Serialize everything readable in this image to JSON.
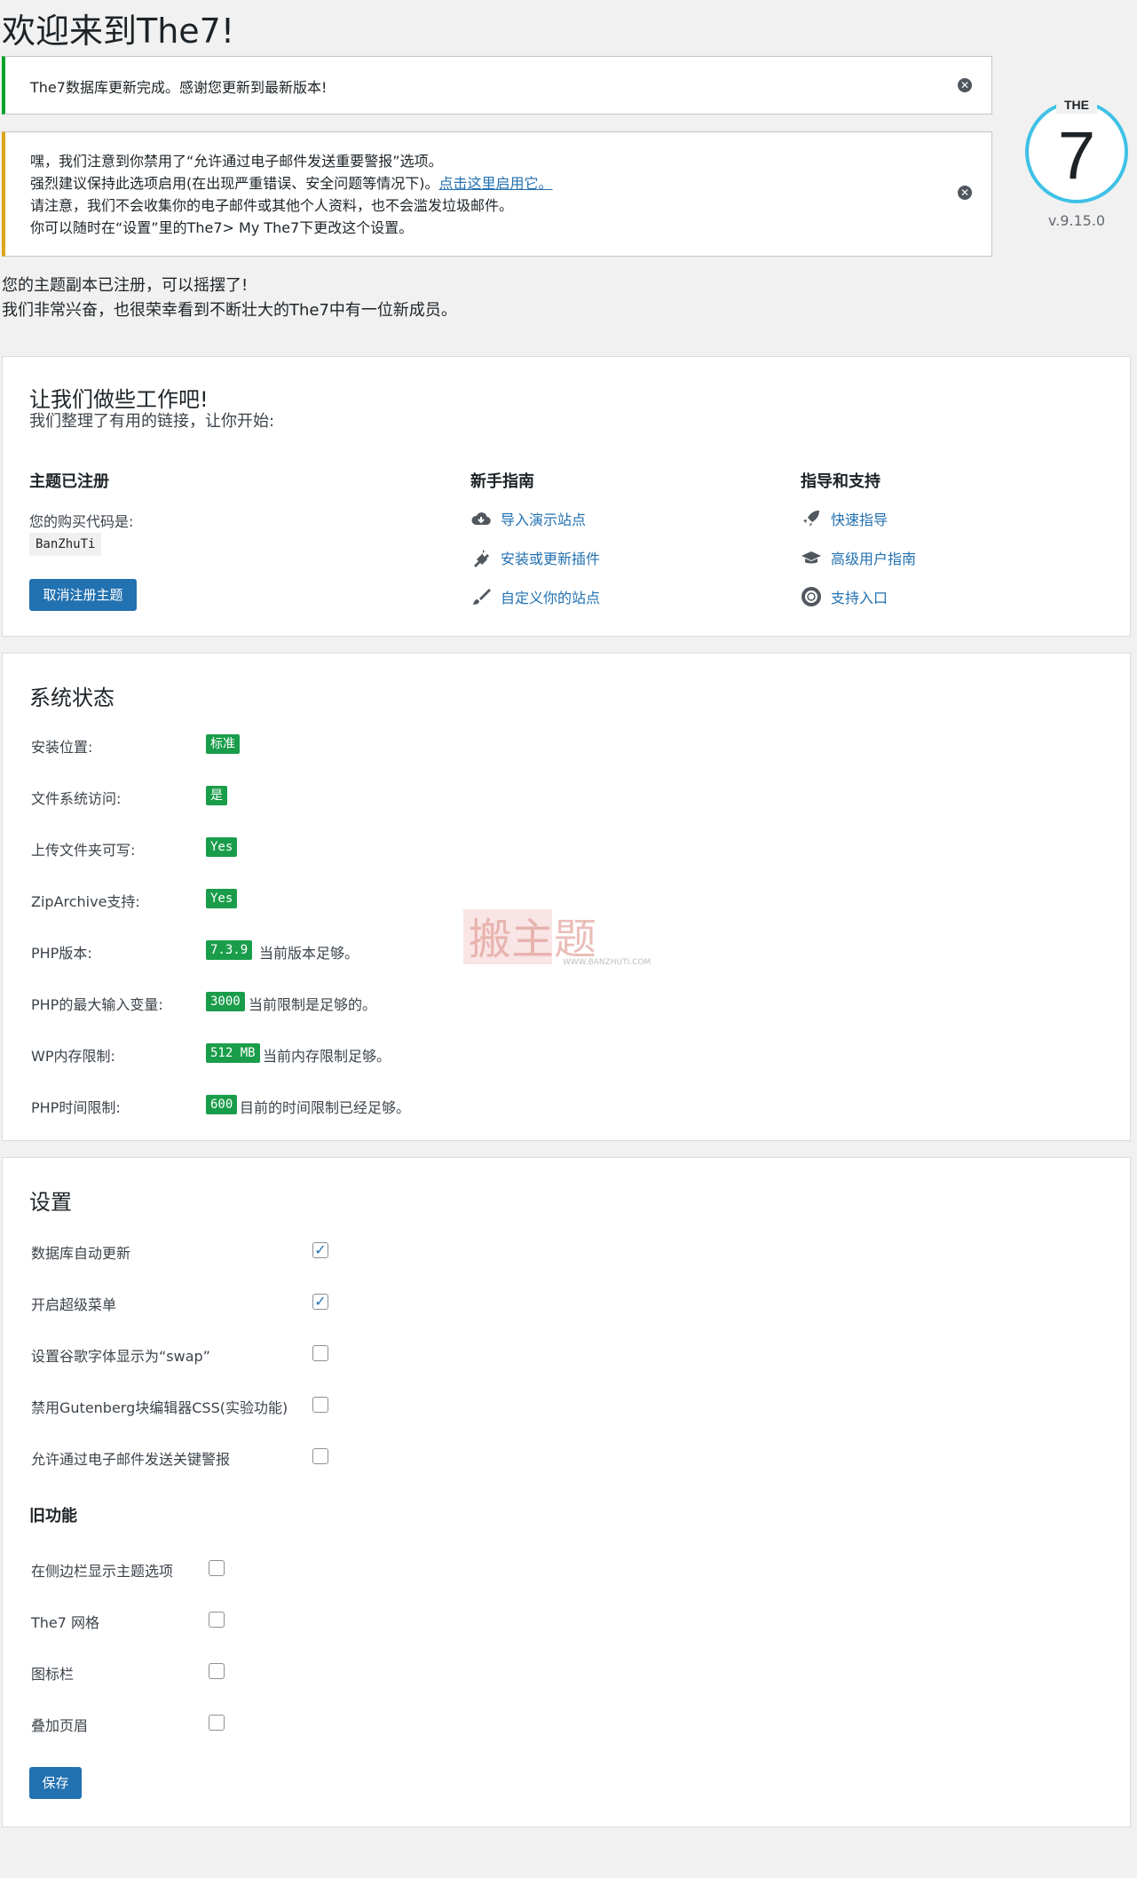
{
  "page_title": "欢迎来到The7!",
  "notices": {
    "success": "The7数据库更新完成。感谢您更新到最新版本!",
    "warning_line1": "嘿，我们注意到你禁用了“允许通过电子邮件发送重要警报”选项。",
    "warning_line2": "强烈建议保持此选项启用(在出现严重错误、安全问题等情况下)。",
    "warning_link": "点击这里启用它。",
    "warning_line3": "请注意，我们不会收集你的电子邮件或其他个人资料，也不会滥发垃圾邮件。",
    "warning_line4": "你可以随时在“设置”里的The7> My The7下更改这个设置。",
    "dismiss_glyph": "✕"
  },
  "logo": {
    "label": "THE",
    "number": "7",
    "version": "v.9.15.0"
  },
  "intro": {
    "line1": "您的主题副本已注册，可以摇摆了!",
    "line2": "我们非常兴奋，也很荣幸看到不断壮大的The7中有一位新成员。"
  },
  "getting_started": {
    "heading": "让我们做些工作吧!",
    "subheading": "我们整理了有用的链接，让你开始:",
    "registered": {
      "heading": "主题已注册",
      "code_label": "您的购买代码是:",
      "code": "BanZhuTi",
      "deregister_button": "取消注册主题"
    },
    "guide": {
      "heading": "新手指南",
      "items": [
        {
          "label": "导入演示站点",
          "icon": "cloud-download-icon"
        },
        {
          "label": "安装或更新插件",
          "icon": "plugin-icon"
        },
        {
          "label": "自定义你的站点",
          "icon": "brush-icon"
        }
      ]
    },
    "support": {
      "heading": "指导和支持",
      "items": [
        {
          "label": "快速指导",
          "icon": "rocket-icon"
        },
        {
          "label": "高级用户指南",
          "icon": "graduation-cap-icon"
        },
        {
          "label": "支持入口",
          "icon": "lifebuoy-icon"
        }
      ]
    }
  },
  "system_status": {
    "heading": "系统状态",
    "rows": [
      {
        "label": "安装位置:",
        "value": "标准",
        "note": ""
      },
      {
        "label": "文件系统访问:",
        "value": "是",
        "note": ""
      },
      {
        "label": "上传文件夹可写:",
        "value": "Yes",
        "note": ""
      },
      {
        "label": "ZipArchive支持:",
        "value": "Yes",
        "note": ""
      },
      {
        "label": "PHP版本:",
        "value": "7.3.9",
        "note": "当前版本足够。"
      },
      {
        "label": "PHP的最大输入变量:",
        "value": "3000",
        "note": "当前限制是足够的。"
      },
      {
        "label": "WP内存限制:",
        "value": "512 MB",
        "note": "当前内存限制足够。"
      },
      {
        "label": "PHP时间限制:",
        "value": "600",
        "note": "目前的时间限制已经足够。"
      }
    ],
    "badge_color": "#1a9d4b"
  },
  "watermark": {
    "brand": "搬主题",
    "url": "WWW.BANZHUTI.COM"
  },
  "settings": {
    "heading": "设置",
    "options": [
      {
        "label": "数据库自动更新",
        "checked": true
      },
      {
        "label": "开启超级菜单",
        "checked": true
      },
      {
        "label": "设置谷歌字体显示为“swap”",
        "checked": false
      },
      {
        "label": "禁用Gutenberg块编辑器CSS(实验功能)",
        "checked": false
      },
      {
        "label": "允许通过电子邮件发送关键警报",
        "checked": false
      }
    ],
    "legacy_heading": "旧功能",
    "legacy_options": [
      {
        "label": "在侧边栏显示主题选项",
        "checked": false
      },
      {
        "label": "The7 网格",
        "checked": false
      },
      {
        "label": "图标栏",
        "checked": false
      },
      {
        "label": "叠加页眉",
        "checked": false
      }
    ],
    "save_button": "保存"
  },
  "colors": {
    "primary": "#2271b1",
    "success": "#00a32a",
    "warning": "#dba617",
    "logo_ring": "#3fc1e6"
  }
}
